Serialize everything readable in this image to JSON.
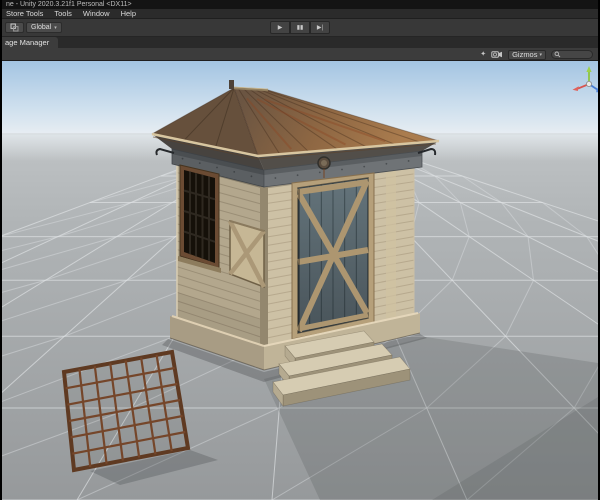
{
  "titlebar": {
    "title": "ne - Unity 2020.3.21f1 Personal <DX11>"
  },
  "menubar": {
    "items": [
      "Store Tools",
      "Tools",
      "Window",
      "Help"
    ]
  },
  "toolbar": {
    "global_label": "Global",
    "global_arrow": "▾",
    "play_icon": "▶",
    "pause_icon": "▮▮",
    "step_icon": "▶|"
  },
  "tabbar": {
    "active_tab": "age Manager"
  },
  "scene_toolbar": {
    "effects_icon": "✦",
    "gizmos_label": "Gizmos",
    "gizmos_arrow": "▾"
  },
  "scene": {
    "colors": {
      "sky_top": "#a3c4e2",
      "sky_horizon": "#e7edf2",
      "ground_far": "#c0c4c6",
      "ground_near": "#96999b",
      "grid_line": "#e2e5e7",
      "axis_x": "#d8544f",
      "axis_y": "#8ec63f",
      "axis_z": "#4a7fd4",
      "roof_rust": "#95693f",
      "wall_wood_left": "#b3a78d",
      "wall_wood_right": "#cdc1a5",
      "door_panel": "#5c6b71",
      "grate_rust": "#75462a"
    }
  }
}
